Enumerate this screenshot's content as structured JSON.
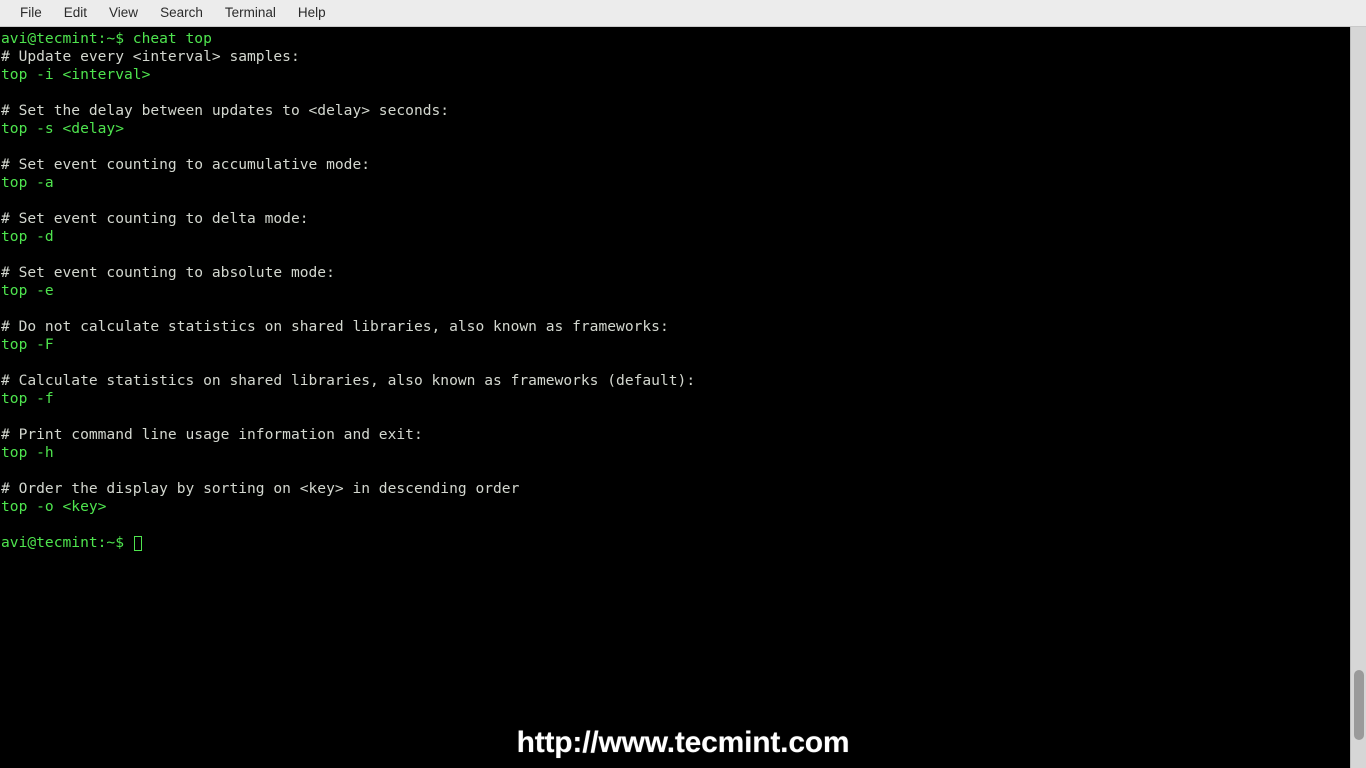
{
  "window": {
    "title": "Terminal",
    "background": "#000000",
    "menubar_background": "#ececec",
    "prompt_color": "#4ee44e",
    "comment_color": "#d3d7cf"
  },
  "menubar": {
    "items": [
      {
        "label": "File"
      },
      {
        "label": "Edit"
      },
      {
        "label": "View"
      },
      {
        "label": "Search"
      },
      {
        "label": "Terminal"
      },
      {
        "label": "Help"
      }
    ]
  },
  "terminal": {
    "prompt": "avi@tecmint:~$ ",
    "command": "cheat top",
    "first_line": "avi@tecmint:~$ cheat top",
    "lines": [
      {
        "text": "avi@tecmint:~$ cheat top",
        "style": "green"
      },
      {
        "text": "# Update every <interval> samples:",
        "style": "comment"
      },
      {
        "text": "top -i <interval>",
        "style": "green"
      },
      {
        "text": "",
        "style": "blank"
      },
      {
        "text": "# Set the delay between updates to <delay> seconds:",
        "style": "comment"
      },
      {
        "text": "top -s <delay>",
        "style": "green"
      },
      {
        "text": "",
        "style": "blank"
      },
      {
        "text": "# Set event counting to accumulative mode:",
        "style": "comment"
      },
      {
        "text": "top -a",
        "style": "green"
      },
      {
        "text": "",
        "style": "blank"
      },
      {
        "text": "# Set event counting to delta mode:",
        "style": "comment"
      },
      {
        "text": "top -d",
        "style": "green"
      },
      {
        "text": "",
        "style": "blank"
      },
      {
        "text": "# Set event counting to absolute mode:",
        "style": "comment"
      },
      {
        "text": "top -e",
        "style": "green"
      },
      {
        "text": "",
        "style": "blank"
      },
      {
        "text": "# Do not calculate statistics on shared libraries, also known as frameworks:",
        "style": "comment"
      },
      {
        "text": "top -F",
        "style": "green"
      },
      {
        "text": "",
        "style": "blank"
      },
      {
        "text": "# Calculate statistics on shared libraries, also known as frameworks (default):",
        "style": "comment"
      },
      {
        "text": "top -f",
        "style": "green"
      },
      {
        "text": "",
        "style": "blank"
      },
      {
        "text": "# Print command line usage information and exit:",
        "style": "comment"
      },
      {
        "text": "top -h",
        "style": "green"
      },
      {
        "text": "",
        "style": "blank"
      },
      {
        "text": "# Order the display by sorting on <key> in descending order",
        "style": "comment"
      },
      {
        "text": "top -o <key>",
        "style": "green"
      },
      {
        "text": "",
        "style": "blank"
      }
    ],
    "final_prompt": "avi@tecmint:~$ "
  },
  "scrollbar": {
    "track_color": "#d6d6d6",
    "thumb_color": "#9a9a9a"
  },
  "watermark": {
    "text": "http://www.tecmint.com"
  }
}
